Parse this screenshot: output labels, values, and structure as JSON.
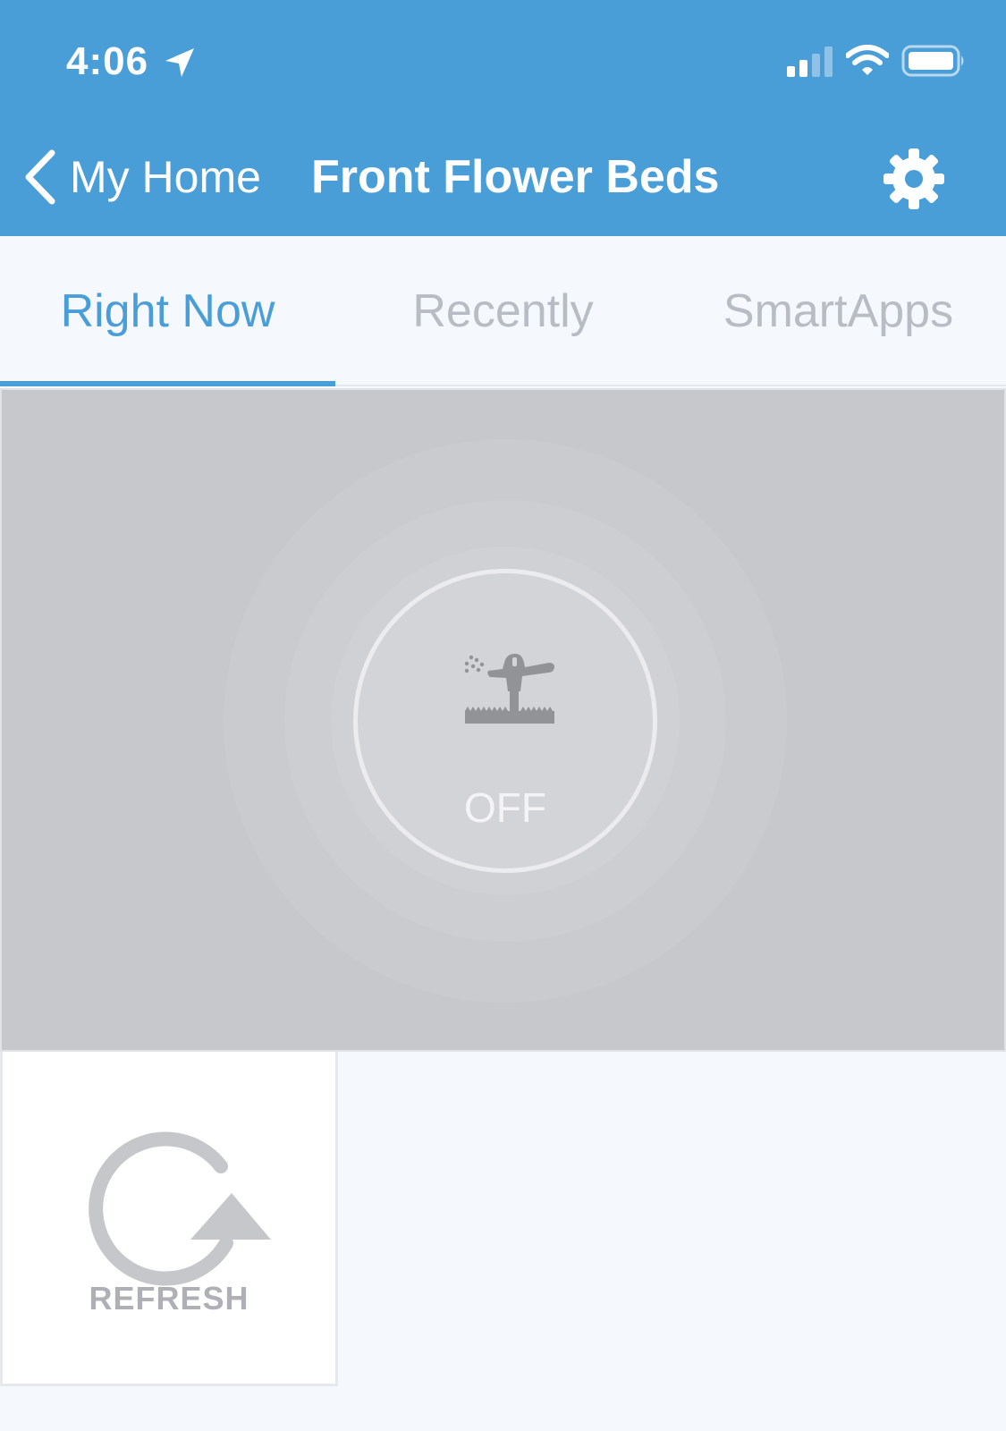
{
  "status_bar": {
    "time": "4:06",
    "icons": [
      "location-arrow-icon",
      "cellular-signal-icon",
      "wifi-icon",
      "battery-icon"
    ]
  },
  "nav": {
    "back_label": "My Home",
    "title": "Front Flower Beds",
    "settings_icon": "gear-icon"
  },
  "tabs": [
    {
      "label": "Right Now",
      "active": true
    },
    {
      "label": "Recently",
      "active": false
    },
    {
      "label": "SmartApps",
      "active": false
    }
  ],
  "main_tile": {
    "icon": "sprinkler-icon",
    "state": "OFF"
  },
  "refresh_tile": {
    "icon": "refresh-icon",
    "label": "REFRESH"
  },
  "colors": {
    "accent": "#4a9ed8",
    "tab_inactive": "#b8bcc4",
    "tile_off": "#c7c8cc",
    "background": "#f5f8fd"
  }
}
